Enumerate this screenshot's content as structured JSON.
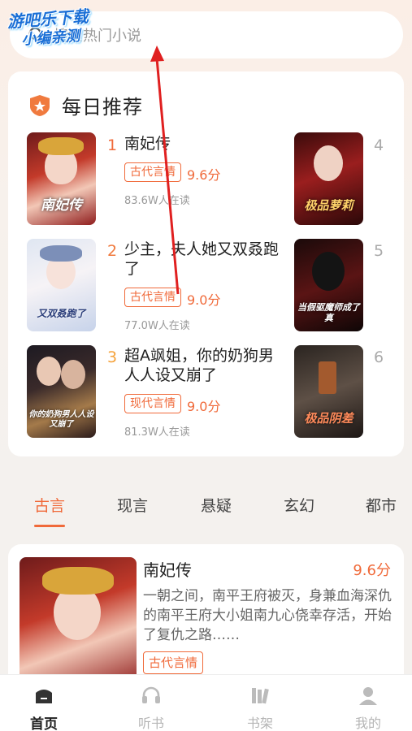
{
  "search": {
    "placeholder": "搜索热门小说"
  },
  "watermark": {
    "line1": "游吧乐下载",
    "line2": "小编亲测"
  },
  "daily": {
    "title": "每日推荐",
    "items": [
      {
        "rank": "1",
        "title": "南妃传",
        "tag": "古代言情",
        "score": "9.6分",
        "readers": "83.6W人在读",
        "cover_text": "南妃传"
      },
      {
        "rank": "2",
        "title": "少主，夫人她又双叒跑了",
        "tag": "古代言情",
        "score": "9.0分",
        "readers": "77.0W人在读",
        "cover_text": "又双叒跑了"
      },
      {
        "rank": "3",
        "title": "超A飒姐，你的奶狗男人人设又崩了",
        "tag": "现代言情",
        "score": "9.0分",
        "readers": "81.3W人在读",
        "cover_text": "你的奶狗男人人设又崩了"
      },
      {
        "rank": "4",
        "cover_text": "极品萝莉"
      },
      {
        "rank": "5",
        "cover_text": "当假驱魔师成了真"
      },
      {
        "rank": "6",
        "cover_text": "极品阴差"
      }
    ]
  },
  "tabs": [
    "古言",
    "现言",
    "悬疑",
    "玄幻",
    "都市"
  ],
  "feature": {
    "title": "南妃传",
    "score": "9.6分",
    "description": "一朝之间，南平王府被灭，身兼血海深仇的南平王府大小姐南九心侥幸存活，开始了复仇之路……",
    "tag": "古代言情"
  },
  "nav": [
    {
      "label": "首页",
      "icon": "home-icon"
    },
    {
      "label": "听书",
      "icon": "headphones-icon"
    },
    {
      "label": "书架",
      "icon": "bookshelf-icon"
    },
    {
      "label": "我的",
      "icon": "user-icon"
    }
  ],
  "colors": {
    "accent": "#f06a3a",
    "background": "#f4f1ee",
    "annotation": "#e02020"
  }
}
